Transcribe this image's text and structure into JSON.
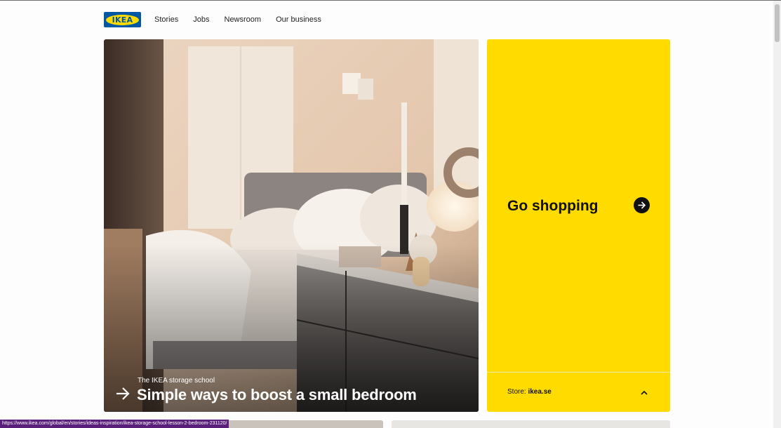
{
  "brand": {
    "logo_text": "IKEA",
    "colors": {
      "blue": "#0058a3",
      "yellow": "#ffdb00"
    }
  },
  "nav": {
    "items": [
      {
        "label": "Stories"
      },
      {
        "label": "Jobs"
      },
      {
        "label": "Newsroom"
      },
      {
        "label": "Our business"
      }
    ]
  },
  "hero": {
    "image_icon": "bedroom-photo",
    "kicker": "The IKEA storage school",
    "title": "Simple ways to boost a small bedroom",
    "arrow_icon": "arrow-right-icon"
  },
  "shop": {
    "title": "Go shopping",
    "button_icon": "arrow-right-circle-icon",
    "store_label": "Store:",
    "store_value": "ikea.se",
    "caret_icon": "chevron-up-icon"
  },
  "status_bar": {
    "url": "https://www.ikea.com/global/en/stories/ideas-inspiration/ikea-storage-school-lesson-2-bedroom-231120/"
  }
}
